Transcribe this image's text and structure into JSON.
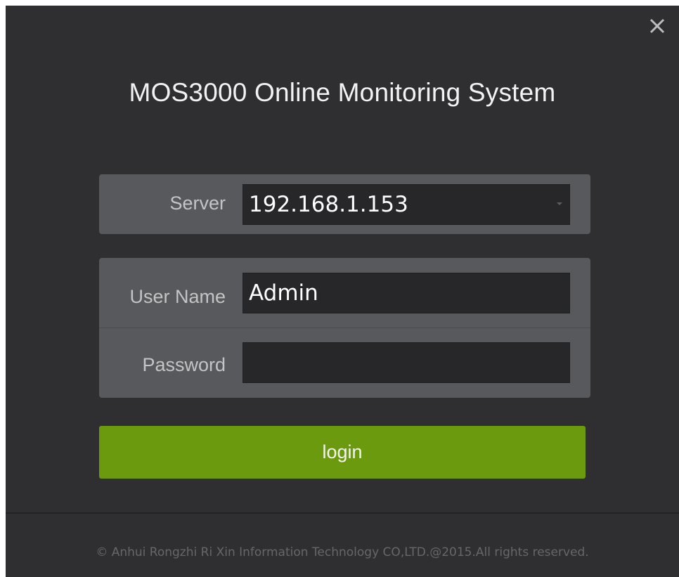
{
  "dialog": {
    "title": "MOS3000 Online Monitoring System",
    "close_icon": "close-icon"
  },
  "server": {
    "label": "Server",
    "value": "192.168.1.153",
    "dropdown_icon": "chevron-down-icon"
  },
  "username": {
    "label": "User Name",
    "value": "Admin"
  },
  "password": {
    "label": "Password",
    "value": ""
  },
  "login": {
    "label": "login"
  },
  "footer": {
    "copyright": "© Anhui Rongzhi Ri Xin Information Technology CO,LTD.@2015.All rights reserved."
  },
  "colors": {
    "background": "#2f2f31",
    "panel": "#58595c",
    "field": "#272729",
    "accent_button": "#6c9a0f"
  }
}
